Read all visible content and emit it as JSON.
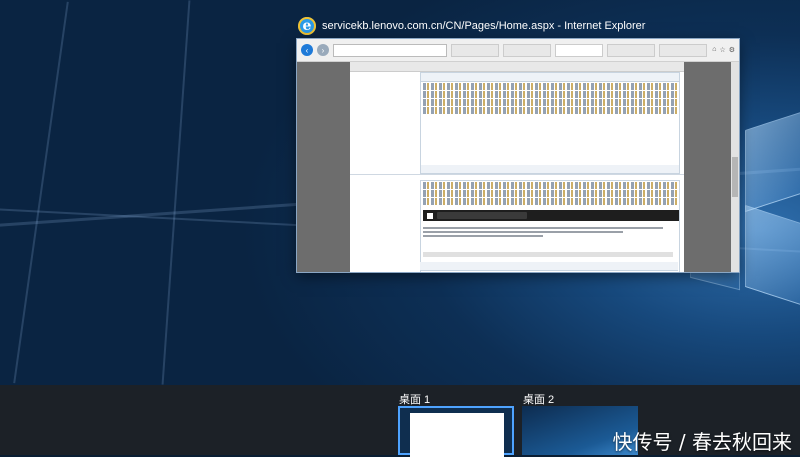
{
  "window": {
    "title": "servicekb.lenovo.com.cn/CN/Pages/Home.aspx - Internet Explorer",
    "app_icon": "internet-explorer-icon"
  },
  "desktops": [
    {
      "label": "桌面 1"
    },
    {
      "label": "桌面 2"
    }
  ],
  "watermark": "快传号 / 春去秋回来",
  "colors": {
    "accent": "#4ea3ff",
    "taskbar": "#1c2127",
    "wallpaper": "#17497d"
  }
}
